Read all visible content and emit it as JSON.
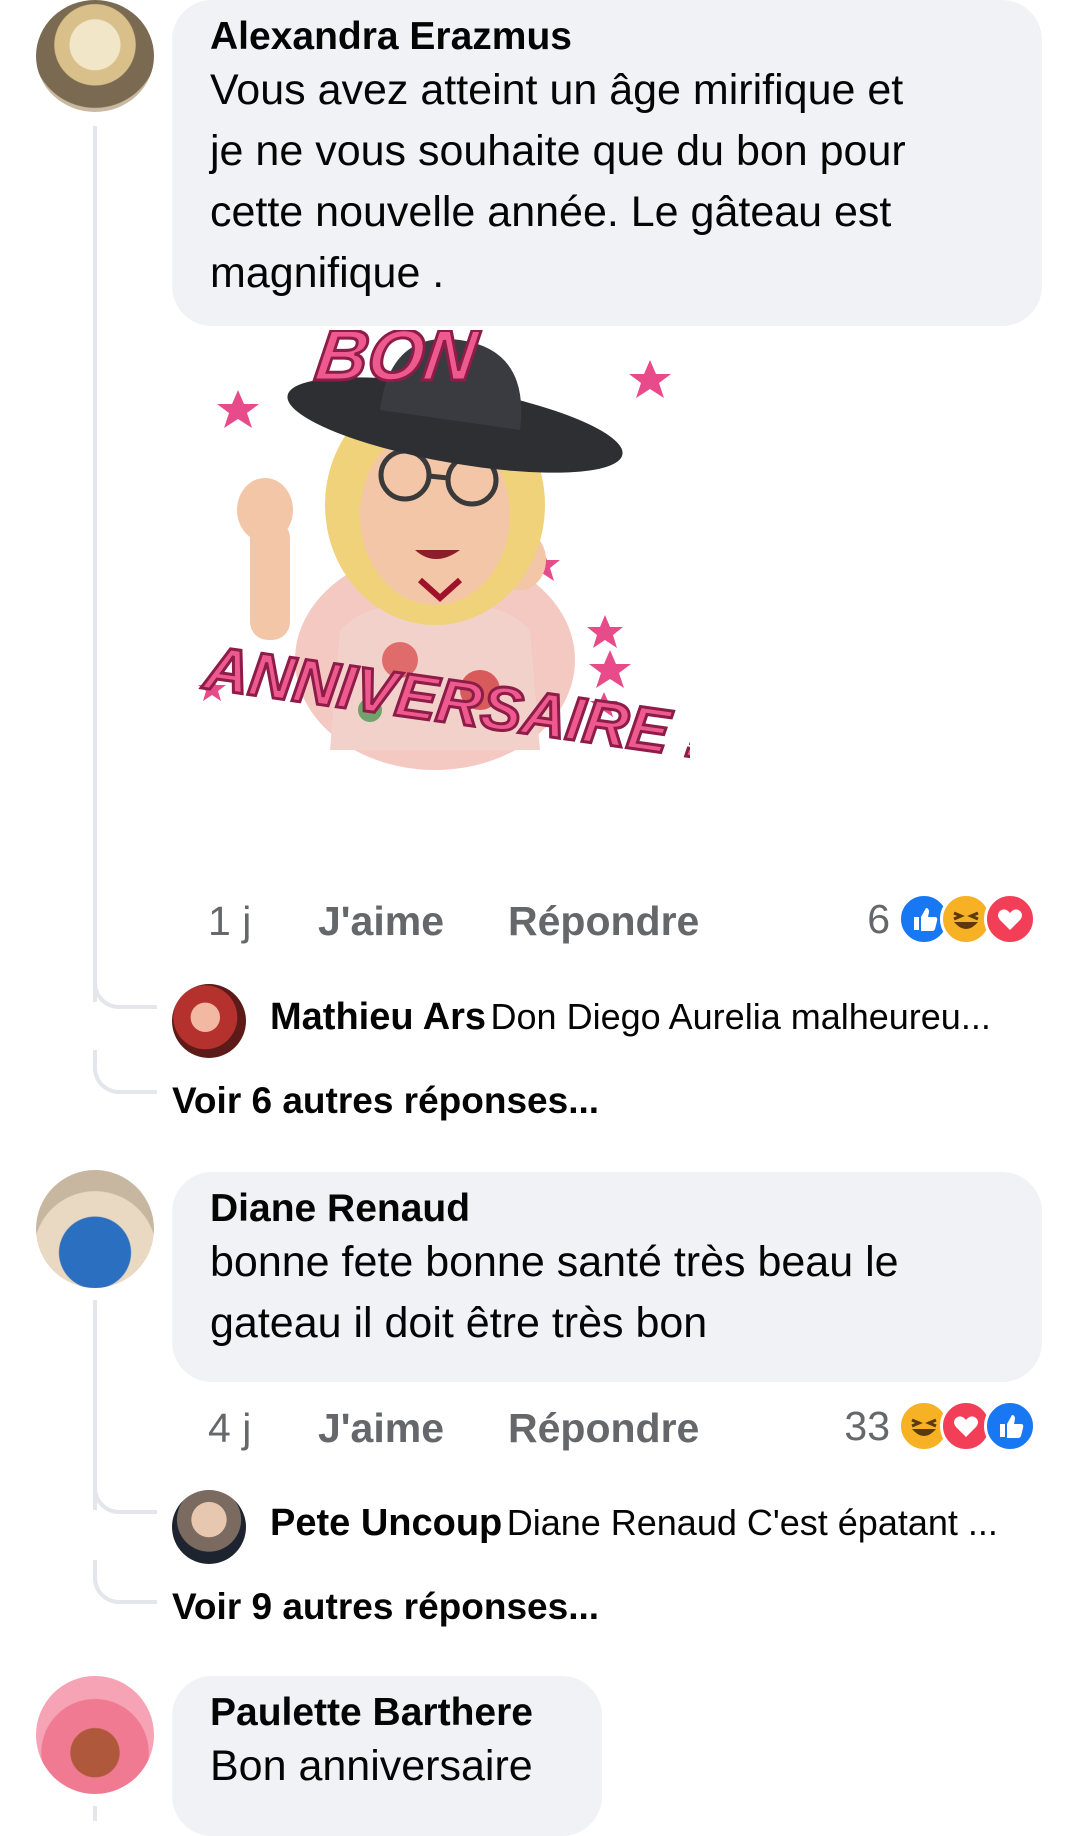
{
  "comments": [
    {
      "author": "Alexandra Erazmus",
      "text_lines": [
        "Vous avez atteint un âge mirifique et",
        "je ne vous souhaite que du bon pour",
        "cette nouvelle année. Le gâteau est",
        "magnifique ."
      ],
      "sticker": {
        "top": "BON",
        "bottom": "ANNIVERSAIRE !"
      },
      "time": "1 j",
      "like_label": "J'aime",
      "reply_label": "Répondre",
      "reaction_count": "6",
      "reactions": [
        "like-icon",
        "haha-icon",
        "love-icon"
      ],
      "reply": {
        "name": "Mathieu Ars",
        "text": "Don Diego Aurelia malheureu..."
      },
      "more_replies": "Voir 6 autres réponses..."
    },
    {
      "author": "Diane Renaud",
      "text_lines": [
        "bonne  fete bonne santé très beau le",
        "gateau il doit être très bon"
      ],
      "time": "4 j",
      "like_label": "J'aime",
      "reply_label": "Répondre",
      "reaction_count": "33",
      "reactions": [
        "haha-icon",
        "love-icon",
        "like-icon"
      ],
      "reply": {
        "name": "Pete Uncoup",
        "text": "Diane Renaud C'est épatant ..."
      },
      "more_replies": "Voir 9 autres réponses..."
    },
    {
      "author": "Paulette Barthere",
      "text_lines": [
        "Bon anniversaire"
      ]
    }
  ],
  "colors": {
    "bubble": "#f0f2f5",
    "meta": "#65676b",
    "like_blue": "#1877f2",
    "love_red": "#f33e58",
    "haha_yellow": "#f7b125",
    "sticker_pink": "#e84b8a"
  }
}
